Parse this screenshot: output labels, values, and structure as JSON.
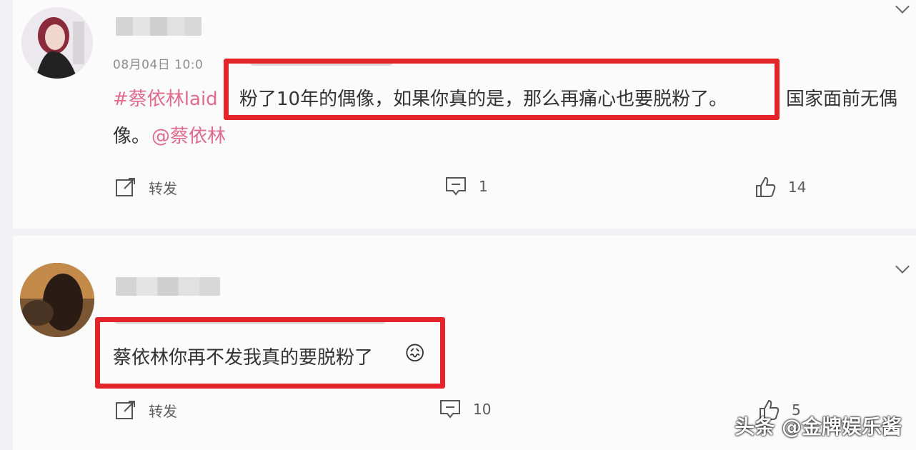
{
  "post1": {
    "timestamp": "08月04日 10:0",
    "text_prefix": "#蔡依林laid",
    "text_boxed": "粉了10年的偶像，如果你真的是，那么再痛心也要脱粉了。",
    "text_suffix": "国家面前无偶",
    "text_line2": "像。",
    "mention": "@蔡依林",
    "repost_label": "转发",
    "comment_count": "1",
    "like_count": "14"
  },
  "post2": {
    "text_boxed": "蔡依林你再不发我真的要脱粉了",
    "emoji": "😖",
    "repost_label": "转发",
    "comment_count": "10",
    "like_count": "5"
  },
  "watermark": "头条 @金牌娱乐酱",
  "colors": {
    "highlight_box": "#e3242b",
    "mention": "#e06a8c"
  }
}
